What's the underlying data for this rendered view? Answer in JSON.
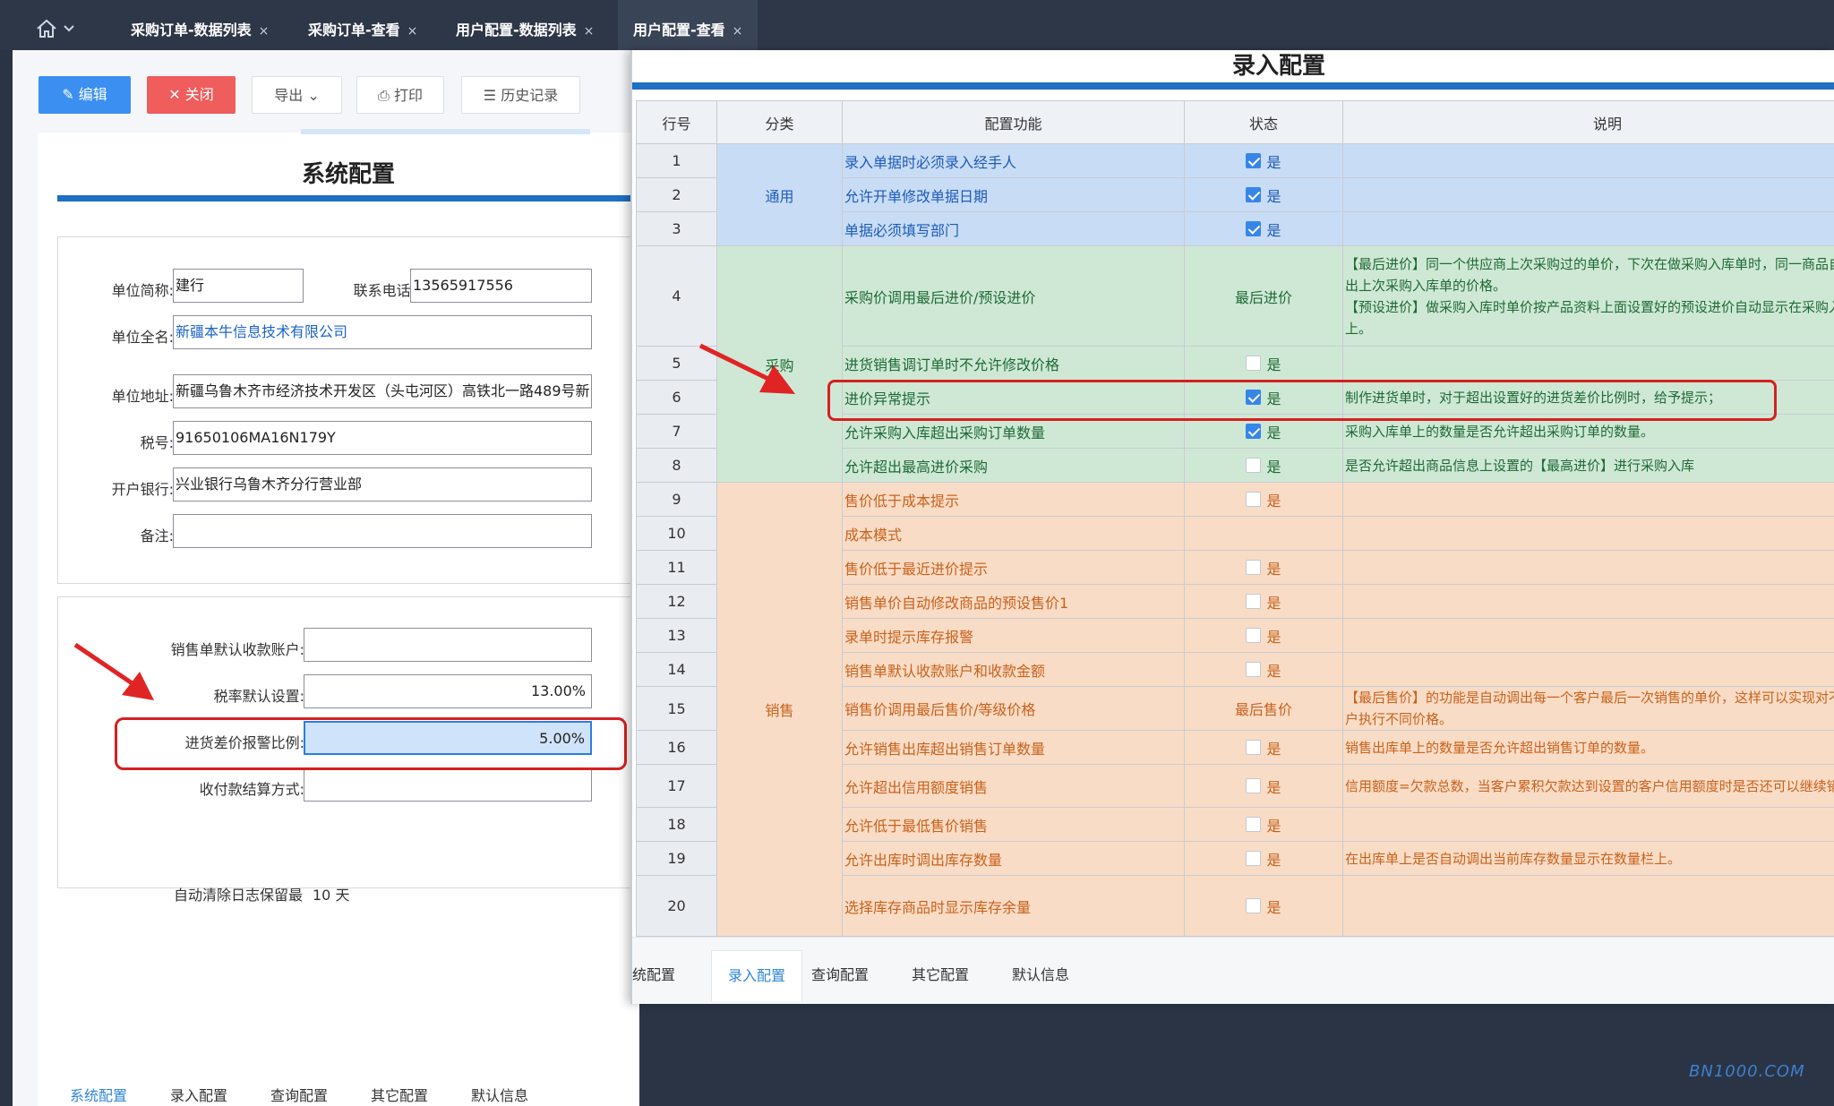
{
  "topbar": {
    "tabs": [
      {
        "label": "采购订单-数据列表",
        "close": "×"
      },
      {
        "label": "采购订单-查看",
        "close": "×"
      },
      {
        "label": "用户配置-数据列表",
        "close": "×"
      },
      {
        "label": "用户配置-查看",
        "close": "×"
      }
    ]
  },
  "toolbar": {
    "edit": "编辑",
    "close": "关闭",
    "export": "导出",
    "print": "打印",
    "history": "历史记录"
  },
  "system": {
    "title": "系统配置",
    "short_name_label": "单位简称:",
    "short_name": "建行",
    "phone_label": "联系电话:",
    "phone": "13565917556",
    "full_name_label": "单位全名:",
    "full_name": "新疆本牛信息技术有限公司",
    "address_label": "单位地址:",
    "address": "新疆乌鲁木齐市经济技术开发区（头屯河区）高铁北一路489号新",
    "tax_label": "税号:",
    "tax": "91650106MA16N179Y",
    "bank_label": "开户银行:",
    "bank": "兴业银行乌鲁木齐分行营业部",
    "remark_label": "备注:",
    "remark": "",
    "sales_account_label": "销售单默认收款账户:",
    "sales_account": "",
    "tax_rate_label": "税率默认设置:",
    "tax_rate": "13.00%",
    "alert_ratio_label": "进货差价报警比例:",
    "alert_ratio": "5.00%",
    "settle_label": "收付款结算方式:",
    "settle": "",
    "log_label": "自动清除日志保留最",
    "log_value": "10 天"
  },
  "left_tabs": [
    "系统配置",
    "录入配置",
    "查询配置",
    "其它配置",
    "默认信息"
  ],
  "dialog": {
    "title": "录入配置",
    "headers": [
      "行号",
      "分类",
      "配置功能",
      "状态",
      "说明"
    ],
    "categories": {
      "tong": "通用",
      "cai": "采购",
      "xiao": "销售"
    },
    "yes": "是",
    "rows": [
      {
        "no": "1",
        "fn": "录入单据时必须录入经手人",
        "check": true,
        "desc": ""
      },
      {
        "no": "2",
        "fn": "允许开单修改单据日期",
        "check": true,
        "desc": ""
      },
      {
        "no": "3",
        "fn": "单据必须填写部门",
        "check": true,
        "desc": ""
      },
      {
        "no": "4",
        "fn": "采购价调用最后进价/预设进价",
        "status_text": "最后进价",
        "desc": "【最后进价】同一个供应商上次采购过的单价，下次在做采购入库单时，同一商品自动带出上次采购入库单的价格。\n【预设进价】做采购入库时单价按产品资料上面设置好的预设进价自动显示在采购入库单上。"
      },
      {
        "no": "5",
        "fn": "进货销售调订单时不允许修改价格",
        "check": false,
        "desc": ""
      },
      {
        "no": "6",
        "fn": "进价异常提示",
        "check": true,
        "desc": "制作进货单时，对于超出设置好的进货差价比例时，给予提示；"
      },
      {
        "no": "7",
        "fn": "允许采购入库超出采购订单数量",
        "check": true,
        "desc": "采购入库单上的数量是否允许超出采购订单的数量。"
      },
      {
        "no": "8",
        "fn": "允许超出最高进价采购",
        "check": false,
        "desc": "是否允许超出商品信息上设置的【最高进价】进行采购入库"
      },
      {
        "no": "9",
        "fn": "售价低于成本提示",
        "check": false,
        "desc": ""
      },
      {
        "no": "10",
        "fn": "成本模式",
        "desc": ""
      },
      {
        "no": "11",
        "fn": "售价低于最近进价提示",
        "check": false,
        "desc": ""
      },
      {
        "no": "12",
        "fn": "销售单价自动修改商品的预设售价1",
        "check": false,
        "desc": ""
      },
      {
        "no": "13",
        "fn": "录单时提示库存报警",
        "check": false,
        "desc": ""
      },
      {
        "no": "14",
        "fn": "销售单默认收款账户和收款金额",
        "check": false,
        "desc": ""
      },
      {
        "no": "15",
        "fn": "销售价调用最后售价/等级价格",
        "status_text": "最后售价",
        "desc": "【最后售价】的功能是自动调出每一个客户最后一次销售的单价，这样可以实现对不同客户执行不同价格。"
      },
      {
        "no": "16",
        "fn": "允许销售出库超出销售订单数量",
        "check": false,
        "desc": "销售出库单上的数量是否允许超出销售订单的数量。"
      },
      {
        "no": "17",
        "fn": "允许超出信用额度销售",
        "check": false,
        "desc": "信用额度=欠款总数，当客户累积欠款达到设置的客户信用额度时是否还可以继续销售"
      },
      {
        "no": "18",
        "fn": "允许低于最低售价销售",
        "check": false,
        "desc": ""
      },
      {
        "no": "19",
        "fn": "允许出库时调出库存数量",
        "check": false,
        "desc": "在出库单上是否自动调出当前库存数量显示在数量栏上。"
      },
      {
        "no": "20",
        "fn": "选择库存商品时显示库存余量",
        "check": false,
        "desc": ""
      }
    ],
    "tabs": [
      "统配置",
      "录入配置",
      "查询配置",
      "其它配置",
      "默认信息"
    ]
  },
  "watermark": "BN1000.COM",
  "colors": {
    "accent": "#1f6fc2",
    "danger": "#d62020",
    "edit": "#3b8ff0",
    "close": "#ef5d5d"
  }
}
